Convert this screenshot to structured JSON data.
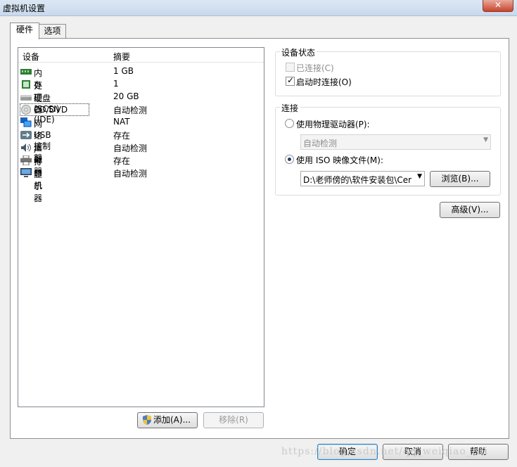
{
  "window": {
    "title": "虚拟机设置",
    "close_symbol": "✕"
  },
  "tabs": [
    {
      "label": "硬件"
    },
    {
      "label": "选项"
    }
  ],
  "device_list": {
    "header": {
      "device": "设备",
      "summary": "摘要"
    },
    "devices": [
      {
        "name": "内存",
        "summary": "1 GB",
        "icon": "memory-icon"
      },
      {
        "name": "处理器",
        "summary": "1",
        "icon": "processor-icon"
      },
      {
        "name": "硬盘(SCSI)",
        "summary": "20 GB",
        "icon": "harddisk-icon"
      },
      {
        "name": "CD/DVD (IDE)",
        "summary": "自动检测",
        "icon": "cd-dvd-icon",
        "selected": true
      },
      {
        "name": "网络适配器",
        "summary": "NAT",
        "icon": "network-adapter-icon"
      },
      {
        "name": "USB 控制器",
        "summary": "存在",
        "icon": "usb-icon"
      },
      {
        "name": "声卡",
        "summary": "自动检测",
        "icon": "sound-card-icon"
      },
      {
        "name": "打印机",
        "summary": "存在",
        "icon": "printer-icon"
      },
      {
        "name": "显示器",
        "summary": "自动检测",
        "icon": "display-icon"
      }
    ]
  },
  "list_buttons": {
    "add": "添加(A)...",
    "remove": "移除(R)"
  },
  "device_status": {
    "title": "设备状态",
    "connected": {
      "label": "已连接(C)",
      "checked": false,
      "enabled": false
    },
    "connect_at_power_on": {
      "label": "启动时连接(O)",
      "checked": true
    }
  },
  "connection": {
    "title": "连接",
    "physical_drive": {
      "label": "使用物理驱动器(P):",
      "selected": false
    },
    "physical_drive_value": "自动检测",
    "iso_image": {
      "label": "使用 ISO 映像文件(M):",
      "selected": true
    },
    "iso_path": "D:\\老师傍的\\软件安装包\\Cer",
    "browse_button": "浏览(B)..."
  },
  "advanced_button": "高级(V)...",
  "footer": {
    "ok": "确定",
    "cancel": "取消",
    "help": "帮助"
  },
  "watermark": "https://blog.csdn.net/qq_weiqiao_rui",
  "colors": {
    "selection_outline": "#333333",
    "group_border": "#dcdcdc",
    "title_bar": "#dce7f4"
  }
}
